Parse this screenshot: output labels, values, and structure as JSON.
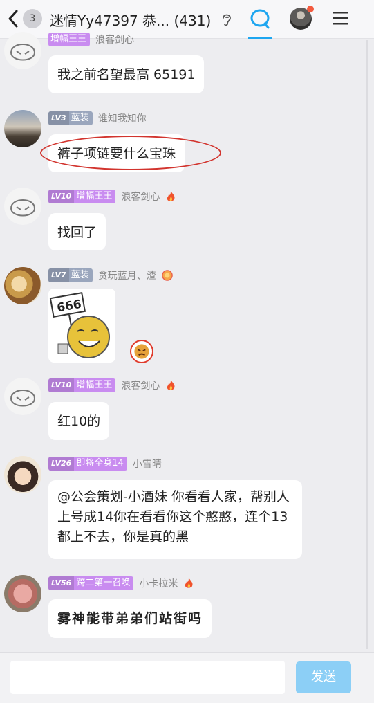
{
  "header": {
    "back_badge_count": "3",
    "title": "迷情Yy47397   恭...  (431)",
    "icons": [
      "chevron-left-icon",
      "ear-icon",
      "chat-bubble-icon",
      "avatar",
      "menu-icon"
    ]
  },
  "messages": [
    {
      "level": "",
      "level_name": "增幅王王",
      "user": "浪客剑心",
      "text": "我之前名望最高 65191"
    },
    {
      "level": "LV3",
      "level_name": "蓝装",
      "user": "谁知我知你",
      "text": "裤子项链要什么宝珠"
    },
    {
      "level": "LV10",
      "level_name": "增幅王王",
      "user": "浪客剑心",
      "text": "找回了"
    },
    {
      "level": "LV7",
      "level_name": "蓝装",
      "user": "贪玩蓝月、渣",
      "sticker_text": "666"
    },
    {
      "level": "LV10",
      "level_name": "增幅王王",
      "user": "浪客剑心",
      "text": "红10的"
    },
    {
      "level": "LV26",
      "level_name": "即将全身14",
      "user": "小雪晴",
      "text": "@公会策划-小酒妹 你看看人家，帮别人上号成14你在看看你这个憨憨，连个13都上不去，你是真的黑"
    },
    {
      "level": "LV56",
      "level_name": "跨二第一召唤",
      "user": "小卡拉米",
      "text": "雾神能带弟弟们站街吗"
    }
  ],
  "input": {
    "placeholder": "",
    "send_label": "发送"
  },
  "colors": {
    "accent": "#1ea6f0",
    "level_purple": "#c98cf0",
    "level_slate": "#9aa6bd",
    "annotation_red": "#d2342e",
    "send_button": "#8ccff6"
  }
}
